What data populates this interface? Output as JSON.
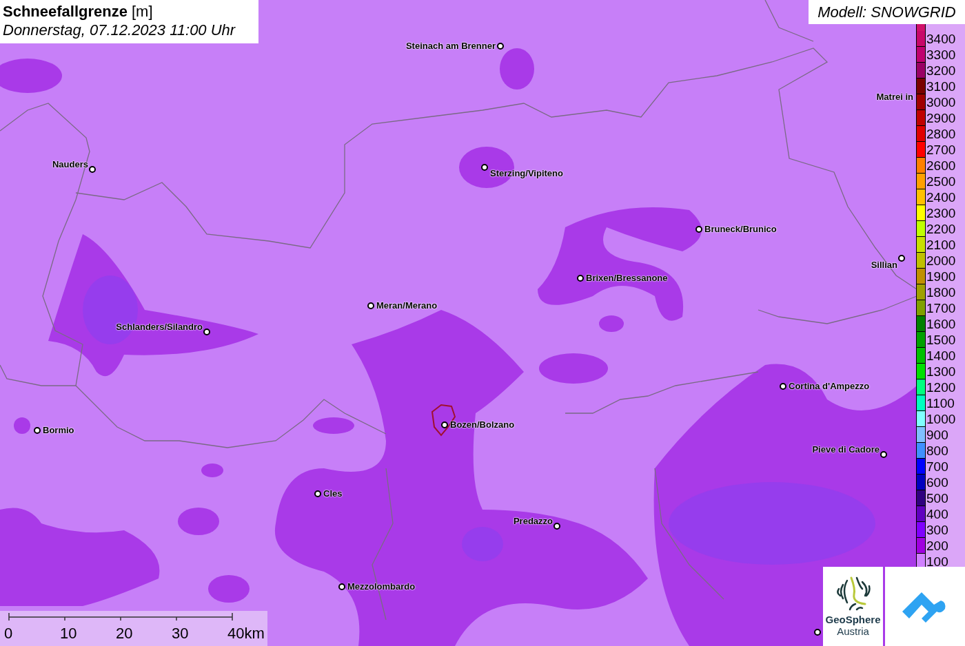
{
  "header": {
    "title": "Schneefallgrenze",
    "unit": "[m]",
    "date": "Donnerstag, 07.12.2023 11:00 Uhr"
  },
  "model": "Modell: SNOWGRID",
  "places": [
    {
      "name": "Steinach am Brenner"
    },
    {
      "name": "Nauders"
    },
    {
      "name": "Sterzing/Vipiteno"
    },
    {
      "name": "Bruneck/Brunico"
    },
    {
      "name": "Matrei in"
    },
    {
      "name": "Sillian"
    },
    {
      "name": "Brixen/Bressanone"
    },
    {
      "name": "Meran/Merano"
    },
    {
      "name": "Schlanders/Silandro"
    },
    {
      "name": "Cortina d'Ampezzo"
    },
    {
      "name": "Bormio"
    },
    {
      "name": "Bozen/Bolzano"
    },
    {
      "name": "Pieve di Cadore"
    },
    {
      "name": "Cles"
    },
    {
      "name": "Predazzo"
    },
    {
      "name": "Mezzolombardo"
    }
  ],
  "legend": [
    {
      "label": "3400",
      "color": "#c8086a"
    },
    {
      "label": "3300",
      "color": "#c00070"
    },
    {
      "label": "3200",
      "color": "#9a0066"
    },
    {
      "label": "3100",
      "color": "#7a0000"
    },
    {
      "label": "3000",
      "color": "#a00000"
    },
    {
      "label": "2900",
      "color": "#c00000"
    },
    {
      "label": "2800",
      "color": "#e00000"
    },
    {
      "label": "2700",
      "color": "#ff0000"
    },
    {
      "label": "2600",
      "color": "#ff8000"
    },
    {
      "label": "2500",
      "color": "#ffa000"
    },
    {
      "label": "2400",
      "color": "#ffc000"
    },
    {
      "label": "2300",
      "color": "#ffff00"
    },
    {
      "label": "2200",
      "color": "#c0ff00"
    },
    {
      "label": "2100",
      "color": "#c8e000"
    },
    {
      "label": "2000",
      "color": "#c0c000"
    },
    {
      "label": "1900",
      "color": "#c09000"
    },
    {
      "label": "1800",
      "color": "#a0a000"
    },
    {
      "label": "1700",
      "color": "#80a000"
    },
    {
      "label": "1600",
      "color": "#008000"
    },
    {
      "label": "1500",
      "color": "#00a000"
    },
    {
      "label": "1400",
      "color": "#00c000"
    },
    {
      "label": "1300",
      "color": "#00e000"
    },
    {
      "label": "1200",
      "color": "#00ff80"
    },
    {
      "label": "1100",
      "color": "#00ffc0"
    },
    {
      "label": "1000",
      "color": "#80ffff"
    },
    {
      "label": "900",
      "color": "#80c0ff"
    },
    {
      "label": "800",
      "color": "#4090ff"
    },
    {
      "label": "700",
      "color": "#0000ff"
    },
    {
      "label": "600",
      "color": "#0000c0"
    },
    {
      "label": "500",
      "color": "#300080"
    },
    {
      "label": "400",
      "color": "#6000c0"
    },
    {
      "label": "300",
      "color": "#8000ff"
    },
    {
      "label": "200",
      "color": "#a000e0"
    },
    {
      "label": "100",
      "color": "#d080ff"
    }
  ],
  "scale": [
    "0",
    "10",
    "20",
    "30",
    "40km"
  ],
  "logo": {
    "line1": "GeoSphere",
    "line2": "Austria"
  }
}
